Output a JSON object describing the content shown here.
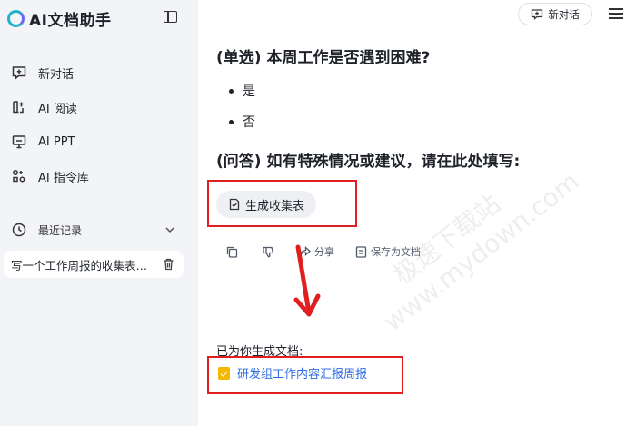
{
  "sidebar": {
    "brand": "AI文档助手",
    "nav": [
      {
        "label": "新对话",
        "icon": "new-chat-icon"
      },
      {
        "label": "AI 阅读",
        "icon": "book-icon"
      },
      {
        "label": "AI PPT",
        "icon": "presentation-icon"
      },
      {
        "label": "AI 指令库",
        "icon": "command-library-icon"
      }
    ],
    "recent_label": "最近记录",
    "history": [
      {
        "title": "写一个工作周报的收集表…"
      }
    ]
  },
  "header": {
    "new_chat_label": "新对话"
  },
  "content": {
    "question1": "(单选) 本周工作是否遇到困难?",
    "options": [
      "是",
      "否"
    ],
    "question2": "(问答) 如有特殊情况或建议，请在此处填写:",
    "generate_button": "生成收集表",
    "actions": {
      "share": "分享",
      "save": "保存为文档"
    },
    "generated_label": "已为你生成文档:",
    "doc_link": "研发组工作内容汇报周报"
  },
  "watermark": {
    "line1": "极速下载站",
    "line2": "www.mydown.com"
  },
  "colors": {
    "sidebar_bg": "#f3f4f7",
    "link": "#2f6ce5",
    "highlight": "#e02020",
    "doc_icon": "#f5b800"
  }
}
